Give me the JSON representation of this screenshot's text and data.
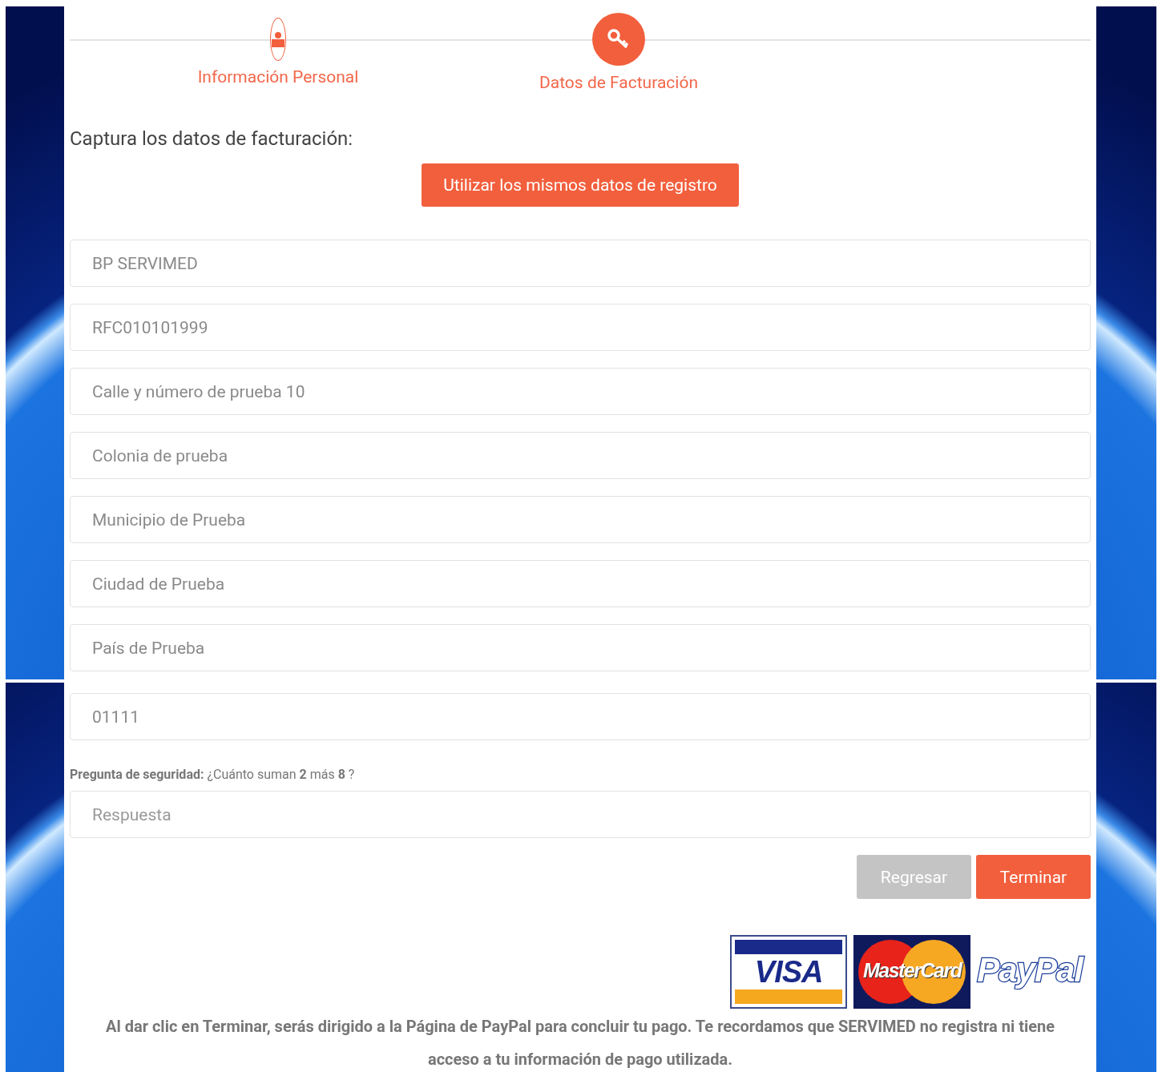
{
  "steps": [
    {
      "label": "Información Personal",
      "kind": "person",
      "selected": false
    },
    {
      "label": "Datos de Facturación",
      "kind": "key",
      "selected": true
    }
  ],
  "intro": "Captura los datos de facturación:",
  "copy_button": "Utilizar los mismos datos de registro",
  "billing_fields": [
    {
      "value": "BP SERVIMED"
    },
    {
      "value": "RFC010101999"
    },
    {
      "value": "Calle y número de prueba 10"
    },
    {
      "value": "Colonia de prueba"
    },
    {
      "value": "Municipio de Prueba"
    },
    {
      "value": "Ciudad de Prueba"
    },
    {
      "value": "País de Prueba"
    }
  ],
  "postal_field": {
    "value": "01111"
  },
  "security_question": "**Pregunta de seguridad:** ¿Cuánto suman **2** más **8** ?",
  "answer_field": {
    "placeholder": "Respuesta"
  },
  "buttons": [
    {
      "label": "Regresar",
      "kind": "secondary"
    },
    {
      "label": "Terminar",
      "kind": "primary"
    }
  ],
  "payment_logos": [
    {
      "kind": "visa",
      "text": "VISA"
    },
    {
      "kind": "mastercard",
      "text": "MasterCard"
    },
    {
      "kind": "paypal",
      "text": "PayPal"
    }
  ],
  "footer_note": "Al dar clic en Terminar, serás dirigido a la Página de PayPal para concluir tu pago. Te recordamos que SERVIMED no registra ni tiene acceso a tu información de pago utilizada."
}
